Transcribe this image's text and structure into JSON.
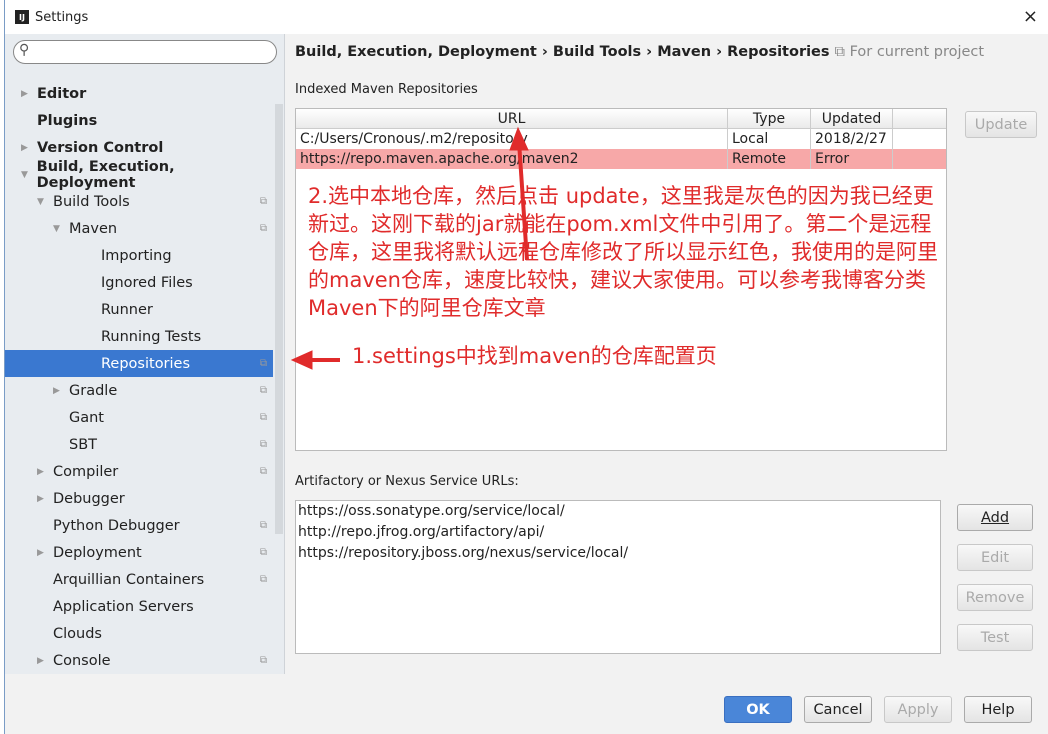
{
  "window": {
    "title": "Settings",
    "logo": "IJ",
    "close": "×"
  },
  "search": {
    "placeholder": "",
    "icon": "search-icon"
  },
  "tree": [
    {
      "label": "Editor",
      "level": 0,
      "bold": true,
      "arrow": "▶",
      "cfg": false
    },
    {
      "label": "Plugins",
      "level": 0,
      "bold": true,
      "arrow": "",
      "cfg": false
    },
    {
      "label": "Version Control",
      "level": 0,
      "bold": true,
      "arrow": "▶",
      "cfg": false
    },
    {
      "label": "Build, Execution, Deployment",
      "level": 0,
      "bold": true,
      "arrow": "▼",
      "cfg": false
    },
    {
      "label": "Build Tools",
      "level": 1,
      "arrow": "▼",
      "cfg": true
    },
    {
      "label": "Maven",
      "level": 2,
      "arrow": "▼",
      "cfg": true
    },
    {
      "label": "Importing",
      "level": 3,
      "arrow": "",
      "cfg": false
    },
    {
      "label": "Ignored Files",
      "level": 3,
      "arrow": "",
      "cfg": false
    },
    {
      "label": "Runner",
      "level": 3,
      "arrow": "",
      "cfg": false
    },
    {
      "label": "Running Tests",
      "level": 3,
      "arrow": "",
      "cfg": false
    },
    {
      "label": "Repositories",
      "level": 3,
      "arrow": "",
      "cfg": true,
      "selected": true
    },
    {
      "label": "Gradle",
      "level": 2,
      "arrow": "▶",
      "cfg": true
    },
    {
      "label": "Gant",
      "level": 2,
      "arrow": "",
      "cfg": true
    },
    {
      "label": "SBT",
      "level": 2,
      "arrow": "",
      "cfg": true
    },
    {
      "label": "Compiler",
      "level": 1,
      "arrow": "▶",
      "cfg": true
    },
    {
      "label": "Debugger",
      "level": 1,
      "arrow": "▶",
      "cfg": false
    },
    {
      "label": "Python Debugger",
      "level": 1,
      "arrow": "",
      "cfg": true
    },
    {
      "label": "Deployment",
      "level": 1,
      "arrow": "▶",
      "cfg": true
    },
    {
      "label": "Arquillian Containers",
      "level": 1,
      "arrow": "",
      "cfg": true
    },
    {
      "label": "Application Servers",
      "level": 1,
      "arrow": "",
      "cfg": false
    },
    {
      "label": "Clouds",
      "level": 1,
      "arrow": "",
      "cfg": false
    },
    {
      "label": "Console",
      "level": 1,
      "arrow": "▶",
      "cfg": true
    }
  ],
  "breadcrumb": {
    "path": "Build, Execution, Deployment › Build Tools › Maven › Repositories",
    "project": "For current project"
  },
  "indexed": {
    "label": "Indexed Maven Repositories",
    "columns": [
      "URL",
      "Type",
      "Updated"
    ],
    "rows": [
      [
        "C:/Users/Cronous/.m2/repository",
        "Local",
        "2018/2/27"
      ],
      [
        "https://repo.maven.apache.org/maven2",
        "Remote",
        "Error"
      ]
    ],
    "update": "Update"
  },
  "services": {
    "label": "Artifactory or Nexus Service URLs:",
    "urls": [
      "https://oss.sonatype.org/service/local/",
      "http://repo.jfrog.org/artifactory/api/",
      "https://repository.jboss.org/nexus/service/local/"
    ],
    "add": "Add",
    "edit": "Edit",
    "remove": "Remove",
    "test": "Test"
  },
  "footer": {
    "ok": "OK",
    "cancel": "Cancel",
    "apply": "Apply",
    "help": "Help"
  },
  "annotations": {
    "note1": "2.选中本地仓库，然后点击 update，这里我是灰色的因为我已经更新过。这刚下载的jar就能在pom.xml文件中引用了。第二个是远程仓库，这里我将默认远程仓库修改了所以显示红色，我使用的是阿里的maven仓库，速度比较快，建议大家使用。可以参考我博客分类Maven下的阿里仓库文章",
    "note2": "1.settings中找到maven的仓库配置页",
    "color": "#e02b2b"
  }
}
